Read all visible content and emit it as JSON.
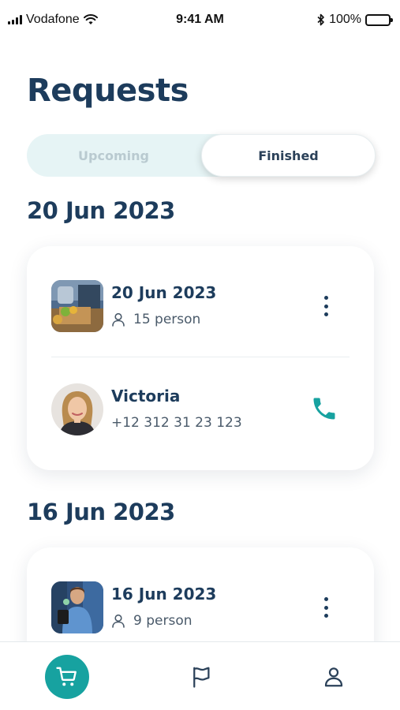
{
  "status_bar": {
    "carrier": "Vodafone",
    "time": "9:41 AM",
    "battery": "100%"
  },
  "page_title": "Requests",
  "tabs": {
    "upcoming": "Upcoming",
    "finished": "Finished",
    "active": "finished"
  },
  "sections": [
    {
      "date_heading": "20 Jun 2023",
      "order_date": "20 Jun 2023",
      "persons": "15 person",
      "contact_name": "Victoria",
      "contact_phone": "+12 312 31 23 123"
    },
    {
      "date_heading": "16 Jun 2023",
      "order_date": "16 Jun 2023",
      "persons": "9 person"
    }
  ],
  "colors": {
    "accent": "#17a2a0",
    "title": "#1d3c5c",
    "tab_bg": "#e6f4f5"
  },
  "icons": {
    "nav": [
      "cart-icon",
      "flag-icon",
      "profile-icon"
    ],
    "call": "phone-icon",
    "more": "more-vertical-icon",
    "person": "person-icon"
  }
}
